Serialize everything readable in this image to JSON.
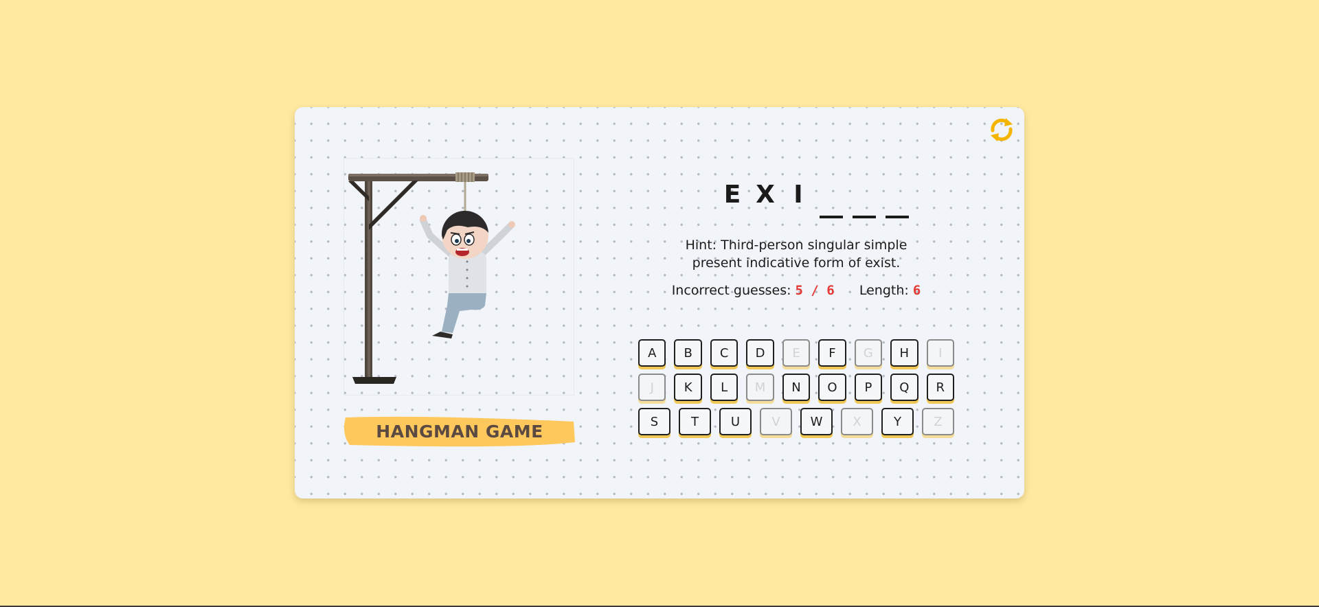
{
  "game": {
    "title": "HANGMAN GAME",
    "refresh_icon": "refresh-icon",
    "accent_color": "#f5b400",
    "word": [
      {
        "char": "E",
        "revealed": true
      },
      {
        "char": "X",
        "revealed": true
      },
      {
        "char": "I",
        "revealed": true
      },
      {
        "char": "",
        "revealed": false
      },
      {
        "char": "",
        "revealed": false
      },
      {
        "char": "",
        "revealed": false
      }
    ],
    "hint": "Hint: Third-person singular simple present indicative form of exist.",
    "incorrect_label": "Incorrect guesses:",
    "incorrect_value": "5 / 6",
    "length_label": "Length:",
    "length_value": "6",
    "keyboard_rows": [
      [
        {
          "label": "A",
          "used": false
        },
        {
          "label": "B",
          "used": false
        },
        {
          "label": "C",
          "used": false
        },
        {
          "label": "D",
          "used": false
        },
        {
          "label": "E",
          "used": true
        },
        {
          "label": "F",
          "used": false
        },
        {
          "label": "G",
          "used": true
        },
        {
          "label": "H",
          "used": false
        },
        {
          "label": "I",
          "used": true
        }
      ],
      [
        {
          "label": "J",
          "used": true
        },
        {
          "label": "K",
          "used": false
        },
        {
          "label": "L",
          "used": false
        },
        {
          "label": "M",
          "used": true
        },
        {
          "label": "N",
          "used": false
        },
        {
          "label": "O",
          "used": false
        },
        {
          "label": "P",
          "used": false
        },
        {
          "label": "Q",
          "used": false
        },
        {
          "label": "R",
          "used": false
        }
      ],
      [
        {
          "label": "S",
          "used": false
        },
        {
          "label": "T",
          "used": false
        },
        {
          "label": "U",
          "used": false
        },
        {
          "label": "V",
          "used": true
        },
        {
          "label": "W",
          "used": false
        },
        {
          "label": "X",
          "used": true
        },
        {
          "label": "Y",
          "used": false
        },
        {
          "label": "Z",
          "used": true
        }
      ]
    ]
  }
}
